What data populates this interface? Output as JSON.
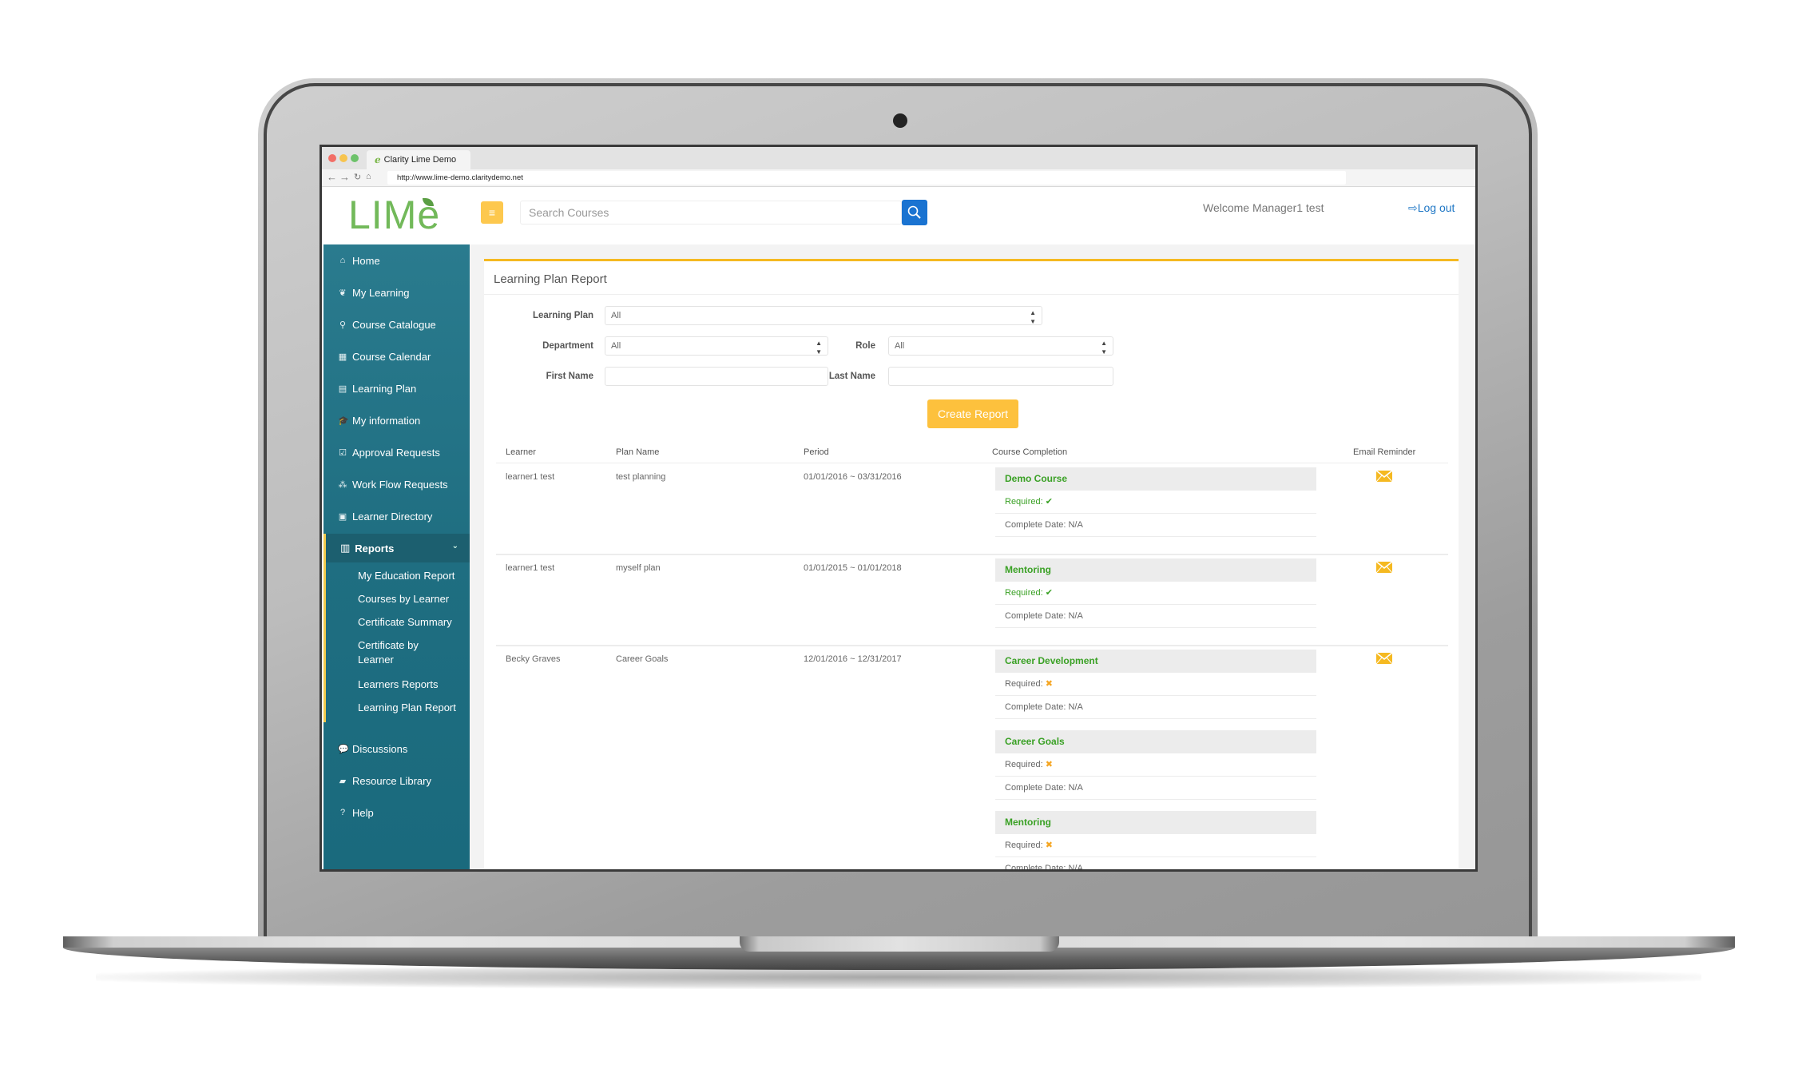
{
  "browser": {
    "tab_title": "Clarity Lime Demo",
    "url": "http://www.lime-demo.claritydemo.net",
    "nav_icons": [
      "back-arrow-icon",
      "forward-arrow-icon",
      "reload-icon",
      "home-icon"
    ]
  },
  "header": {
    "logo_text": "LIMe",
    "menu_toggle_icon": "≡",
    "search_placeholder": "Search Courses",
    "welcome_text": "Welcome Manager1 test",
    "logout_label": "Log out"
  },
  "sidebar": {
    "items": [
      {
        "label": "Home",
        "icon": "home-icon",
        "glyph": "⌂"
      },
      {
        "label": "My Learning",
        "icon": "leaf-icon",
        "glyph": "❦"
      },
      {
        "label": "Course Catalogue",
        "icon": "search-icon",
        "glyph": "⚲"
      },
      {
        "label": "Course Calendar",
        "icon": "calendar-icon",
        "glyph": "▦"
      },
      {
        "label": "Learning Plan",
        "icon": "file-icon",
        "glyph": "▤"
      },
      {
        "label": "My information",
        "icon": "graduation-cap-icon",
        "glyph": "🎓"
      },
      {
        "label": "Approval Requests",
        "icon": "check-square-icon",
        "glyph": "☑"
      },
      {
        "label": "Work Flow Requests",
        "icon": "sitemap-icon",
        "glyph": "⁂"
      },
      {
        "label": "Learner Directory",
        "icon": "address-book-icon",
        "glyph": "▣"
      }
    ],
    "reports": {
      "label": "Reports",
      "icon_glyph": "▥",
      "chevron": "⌄",
      "sub_items": [
        "My Education Report",
        "Courses by Learner",
        "Certificate Summary",
        "Certificate by Learner",
        "Learners Reports",
        "Learning Plan Report"
      ]
    },
    "bottom_items": [
      {
        "label": "Discussions",
        "icon": "comments-icon",
        "glyph": "💬"
      },
      {
        "label": "Resource Library",
        "icon": "book-icon",
        "glyph": "▰"
      },
      {
        "label": "Help",
        "icon": "question-circle-icon",
        "glyph": "?"
      }
    ]
  },
  "report": {
    "title": "Learning Plan Report",
    "filters": {
      "learning_plan_label": "Learning Plan",
      "learning_plan_value": "All",
      "department_label": "Department",
      "department_value": "All",
      "role_label": "Role",
      "role_value": "All",
      "first_name_label": "First Name",
      "first_name_value": "",
      "last_name_label": "Last Name",
      "last_name_value": ""
    },
    "create_button": "Create Report",
    "columns": [
      "Learner",
      "Plan Name",
      "Period",
      "Course Completion",
      "Email Reminder"
    ],
    "rows": [
      {
        "learner": "learner1 test",
        "plan_name": "test planning",
        "period": "01/01/2016 ~ 03/31/2016",
        "courses": [
          {
            "name": "Demo Course",
            "required_label": "Required:",
            "required": true,
            "complete_date": "Complete Date: N/A"
          }
        ]
      },
      {
        "learner": "learner1 test",
        "plan_name": "myself plan",
        "period": "01/01/2015 ~ 01/01/2018",
        "courses": [
          {
            "name": "Mentoring",
            "required_label": "Required:",
            "required": true,
            "complete_date": "Complete Date: N/A"
          }
        ]
      },
      {
        "learner": "Becky Graves",
        "plan_name": "Career Goals",
        "period": "12/01/2016 ~ 12/31/2017",
        "courses": [
          {
            "name": "Career Development",
            "required_label": "Required:",
            "required": false,
            "complete_date": "Complete Date: N/A"
          },
          {
            "name": "Career Goals",
            "required_label": "Required:",
            "required": false,
            "complete_date": "Complete Date: N/A"
          },
          {
            "name": "Mentoring",
            "required_label": "Required:",
            "required": false,
            "complete_date": "Complete Date: N/A"
          }
        ]
      }
    ],
    "marks": {
      "yes": "✔",
      "no": "✖"
    }
  },
  "colors": {
    "sidebar": "#1f6e81",
    "accent_yellow": "#fdc13d",
    "link_blue": "#1f77c5",
    "search_button": "#1a73d1",
    "course_green": "#3aa125",
    "not_required_orange": "#f5a623",
    "logo_green": "#72b95a"
  }
}
